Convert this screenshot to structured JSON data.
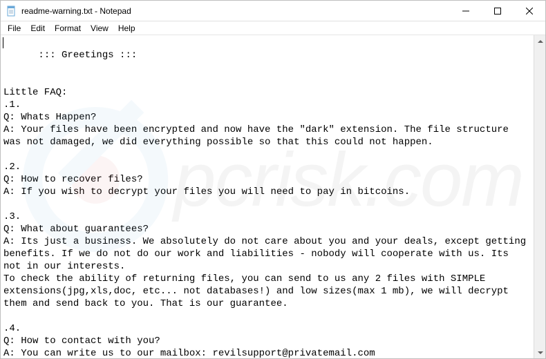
{
  "titlebar": {
    "title": "readme-warning.txt - Notepad"
  },
  "menubar": {
    "file": "File",
    "edit": "Edit",
    "format": "Format",
    "view": "View",
    "help": "Help"
  },
  "document": {
    "content": "::: Greetings :::\n\n\nLittle FAQ:\n.1.\nQ: Whats Happen?\nA: Your files have been encrypted and now have the \"dark\" extension. The file structure was not damaged, we did everything possible so that this could not happen.\n\n.2.\nQ: How to recover files?\nA: If you wish to decrypt your files you will need to pay in bitcoins.\n\n.3.\nQ: What about guarantees?\nA: Its just a business. We absolutely do not care about you and your deals, except getting benefits. If we do not do our work and liabilities - nobody will cooperate with us. Its not in our interests.\nTo check the ability of returning files, you can send to us any 2 files with SIMPLE extensions(jpg,xls,doc, etc... not databases!) and low sizes(max 1 mb), we will decrypt them and send back to you. That is our guarantee.\n\n.4.\nQ: How to contact with you?\nA: You can write us to our mailbox: revilsupport@privatemail.com"
  },
  "watermark": {
    "text": "pcrisk.com"
  }
}
